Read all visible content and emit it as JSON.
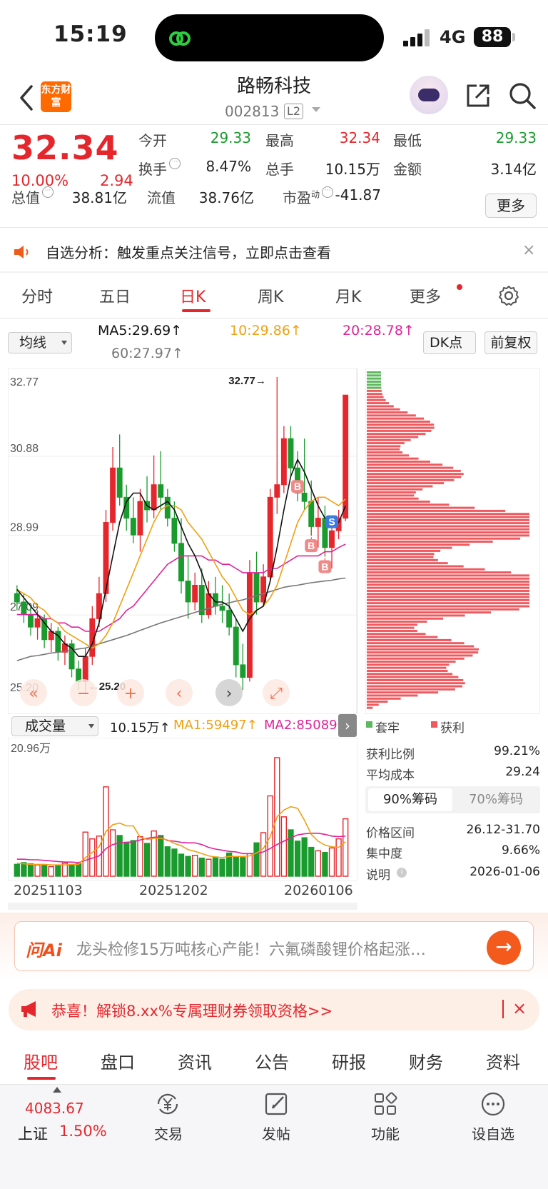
{
  "status": {
    "time": "15:19",
    "network": "4G",
    "battery": "88"
  },
  "header": {
    "logo": "东方财富",
    "name": "路畅科技",
    "code": "002813",
    "level": "L2"
  },
  "quote": {
    "price": "32.34",
    "change_pct": "10.00%",
    "change": "2.94",
    "cells": [
      {
        "label": "今开",
        "value": "29.33",
        "color": "green"
      },
      {
        "label": "最高",
        "value": "32.34",
        "color": "red"
      },
      {
        "label": "最低",
        "value": "29.33",
        "color": "green"
      },
      {
        "label": "换手",
        "value": "8.47%",
        "color": "black"
      },
      {
        "label": "总手",
        "value": "10.15万",
        "color": "black"
      },
      {
        "label": "金额",
        "value": "3.14亿",
        "color": "black"
      },
      {
        "label": "总值",
        "value": "38.81亿",
        "color": "black"
      },
      {
        "label": "流值",
        "value": "38.76亿",
        "color": "black"
      },
      {
        "label": "市盈",
        "value": "-41.87",
        "color": "black"
      }
    ],
    "pe_sup": "动",
    "more_label": "更多"
  },
  "notice": {
    "text": "自选分析：触发重点关注信号，立即点击查看",
    "close": "×"
  },
  "ktabs": [
    "分时",
    "五日",
    "日K",
    "周K",
    "月K",
    "更多"
  ],
  "ma_row": {
    "select": "均线",
    "ma5": "MA5:29.69↑",
    "ma10": "10:29.86↑",
    "ma20": "20:28.78↑",
    "ma60": "60:27.97↑",
    "dk": "DK点",
    "fq": "前复权",
    "colors": {
      "ma5": "#111111",
      "ma10": "#f0a010",
      "ma20": "#e0239a",
      "ma60": "#777777"
    }
  },
  "chart_data": [
    {
      "type": "candlestick",
      "y_ticks": [
        "32.77",
        "30.88",
        "28.99",
        "27.09",
        "25.20"
      ],
      "ylim": [
        25.2,
        32.77
      ],
      "high_label": "32.77→",
      "low_label": "←25.20",
      "markers": [
        "B",
        "B",
        "B",
        "S"
      ],
      "candles": [
        [
          27.6,
          27.8,
          27.2,
          27.4
        ],
        [
          27.4,
          27.6,
          26.9,
          27.1
        ],
        [
          27.1,
          27.3,
          26.6,
          26.8
        ],
        [
          26.8,
          27.2,
          26.5,
          27.0
        ],
        [
          27.0,
          27.1,
          26.3,
          26.5
        ],
        [
          26.5,
          26.9,
          26.2,
          26.7
        ],
        [
          26.7,
          26.8,
          26.0,
          26.2
        ],
        [
          26.2,
          26.6,
          25.9,
          26.4
        ],
        [
          26.4,
          26.5,
          25.6,
          25.8
        ],
        [
          25.8,
          26.0,
          25.3,
          25.5
        ],
        [
          25.5,
          26.3,
          25.2,
          26.1
        ],
        [
          26.1,
          27.3,
          25.9,
          27.0
        ],
        [
          27.0,
          28.0,
          26.8,
          27.6
        ],
        [
          27.6,
          29.6,
          27.4,
          29.3
        ],
        [
          29.3,
          31.1,
          29.1,
          30.6
        ],
        [
          30.6,
          31.4,
          29.7,
          29.9
        ],
        [
          29.9,
          30.2,
          29.1,
          29.4
        ],
        [
          29.4,
          29.9,
          28.8,
          29.0
        ],
        [
          29.0,
          30.1,
          28.6,
          29.8
        ],
        [
          29.8,
          30.4,
          29.3,
          29.6
        ],
        [
          29.6,
          30.9,
          29.4,
          30.2
        ],
        [
          30.2,
          31.0,
          29.6,
          29.9
        ],
        [
          29.9,
          30.1,
          29.2,
          29.4
        ],
        [
          29.4,
          29.8,
          28.6,
          28.8
        ],
        [
          28.8,
          29.4,
          27.6,
          27.9
        ],
        [
          27.9,
          28.5,
          27.0,
          27.4
        ],
        [
          27.4,
          28.1,
          27.2,
          27.8
        ],
        [
          27.8,
          28.2,
          26.9,
          27.1
        ],
        [
          27.1,
          27.9,
          27.0,
          27.6
        ],
        [
          27.6,
          28.0,
          27.1,
          27.3
        ],
        [
          27.3,
          27.8,
          26.9,
          27.2
        ],
        [
          27.2,
          27.6,
          26.6,
          26.8
        ],
        [
          26.8,
          27.0,
          25.6,
          25.9
        ],
        [
          25.9,
          26.4,
          25.3,
          25.6
        ],
        [
          25.6,
          28.4,
          25.5,
          28.1
        ],
        [
          28.1,
          28.6,
          27.1,
          27.4
        ],
        [
          27.4,
          28.3,
          27.3,
          28.0
        ],
        [
          28.0,
          30.1,
          27.9,
          29.9
        ],
        [
          29.9,
          32.77,
          29.5,
          30.2
        ],
        [
          30.2,
          31.6,
          30.0,
          31.3
        ],
        [
          31.3,
          31.6,
          30.4,
          30.6
        ],
        [
          30.6,
          31.0,
          29.8,
          30.0
        ],
        [
          30.0,
          31.3,
          29.6,
          29.8
        ],
        [
          29.8,
          30.3,
          29.0,
          29.2
        ],
        [
          29.2,
          29.9,
          28.7,
          29.4
        ],
        [
          29.4,
          29.7,
          28.5,
          28.7
        ],
        [
          28.7,
          29.4,
          28.2,
          29.1
        ],
        [
          29.1,
          29.6,
          28.9,
          29.4
        ],
        [
          29.4,
          32.34,
          29.33,
          32.34
        ]
      ],
      "ma5": [
        27.7,
        27.5,
        27.3,
        27.1,
        26.9,
        26.7,
        26.6,
        26.4,
        26.3,
        26.1,
        26.1,
        26.4,
        26.9,
        27.7,
        28.5,
        29.3,
        29.8,
        30.0,
        30.0,
        29.7,
        29.6,
        29.7,
        29.8,
        29.6,
        29.2,
        28.8,
        28.5,
        28.1,
        27.6,
        27.4,
        27.4,
        27.3,
        27.0,
        26.7,
        27.0,
        27.2,
        27.3,
        27.9,
        28.7,
        29.6,
        30.4,
        30.8,
        30.5,
        30.1,
        29.7,
        29.4,
        29.3,
        29.3,
        29.69
      ],
      "ma10": [
        27.7,
        27.6,
        27.5,
        27.3,
        27.2,
        27.0,
        26.9,
        26.7,
        26.6,
        26.5,
        26.4,
        26.3,
        26.4,
        26.6,
        26.9,
        27.3,
        27.7,
        28.1,
        28.5,
        28.9,
        29.3,
        29.6,
        29.7,
        29.7,
        29.6,
        29.3,
        29.1,
        28.9,
        28.6,
        28.3,
        28.0,
        27.8,
        27.5,
        27.2,
        27.1,
        27.2,
        27.3,
        27.5,
        27.8,
        28.3,
        28.8,
        29.3,
        29.6,
        29.8,
        29.9,
        29.9,
        29.8,
        29.7,
        29.86
      ],
      "ma20": [
        27.1,
        27.1,
        27.1,
        27.1,
        27.0,
        27.0,
        26.9,
        26.9,
        26.8,
        26.8,
        26.7,
        26.7,
        26.7,
        26.8,
        26.9,
        27.0,
        27.2,
        27.3,
        27.5,
        27.7,
        27.9,
        28.1,
        28.3,
        28.4,
        28.5,
        28.5,
        28.5,
        28.5,
        28.4,
        28.4,
        28.3,
        28.3,
        28.2,
        28.1,
        28.1,
        28.1,
        28.1,
        28.2,
        28.2,
        28.3,
        28.4,
        28.5,
        28.5,
        28.5,
        28.5,
        28.6,
        28.6,
        28.7,
        28.78
      ],
      "ma60": [
        26.0,
        26.05,
        26.1,
        26.12,
        26.15,
        26.18,
        26.2,
        26.22,
        26.25,
        26.28,
        26.3,
        26.35,
        26.4,
        26.45,
        26.5,
        26.55,
        26.6,
        26.66,
        26.72,
        26.78,
        26.84,
        26.9,
        26.95,
        27.0,
        27.05,
        27.1,
        27.15,
        27.2,
        27.25,
        27.3,
        27.35,
        27.38,
        27.42,
        27.45,
        27.5,
        27.55,
        27.6,
        27.65,
        27.7,
        27.75,
        27.78,
        27.8,
        27.83,
        27.86,
        27.88,
        27.9,
        27.92,
        27.95,
        27.97
      ]
    },
    {
      "type": "bar",
      "title": "成交量",
      "y_tick": "20.96万",
      "ylim": [
        0,
        20.96
      ],
      "x_tick_labels": [
        "20251103",
        "20251202",
        "20260106"
      ],
      "values": [
        2.1,
        2.4,
        2.2,
        2.0,
        1.9,
        1.7,
        1.9,
        2.3,
        2.0,
        2.2,
        7.8,
        6.6,
        7.1,
        15.8,
        8.2,
        7.2,
        6.0,
        6.3,
        7.0,
        5.8,
        8.0,
        7.2,
        5.2,
        4.8,
        3.9,
        3.5,
        3.7,
        3.2,
        3.0,
        3.4,
        3.0,
        4.1,
        3.5,
        3.3,
        4.0,
        5.9,
        7.7,
        14.2,
        20.96,
        10.5,
        8.2,
        6.2,
        6.8,
        5.1,
        4.5,
        4.2,
        5.0,
        6.6,
        10.15
      ],
      "ma1": [
        2.3,
        2.2,
        2.1,
        2.1,
        2.1,
        2.0,
        2.0,
        2.0,
        2.1,
        2.1,
        3.3,
        4.2,
        5.2,
        7.9,
        9.1,
        9.4,
        8.9,
        8.9,
        6.9,
        6.5,
        6.7,
        6.7,
        6.4,
        5.8,
        5.4,
        4.7,
        4.4,
        4.0,
        3.6,
        3.4,
        3.3,
        3.5,
        3.5,
        3.5,
        3.6,
        4.1,
        4.9,
        7.0,
        10.5,
        11.7,
        12.3,
        12.0,
        9.9,
        7.4,
        6.2,
        5.5,
        5.2,
        5.1,
        6.1
      ],
      "ma2": [
        3.0,
        3.0,
        2.9,
        2.9,
        2.8,
        2.7,
        2.6,
        2.5,
        2.5,
        2.4,
        2.8,
        3.2,
        3.6,
        4.9,
        5.6,
        5.9,
        6.0,
        6.1,
        6.4,
        6.7,
        6.9,
        6.9,
        6.3,
        6.2,
        6.0,
        5.9,
        5.9,
        5.6,
        5.1,
        4.8,
        4.6,
        4.4,
        4.3,
        4.0,
        4.0,
        4.0,
        4.3,
        4.9,
        5.6,
        6.2,
        6.8,
        7.3,
        7.5,
        7.6,
        7.6,
        7.4,
        7.1,
        7.0,
        7.1
      ],
      "legend": {
        "vol": "10.15万↑",
        "ma1": "MA1:59497↑",
        "ma2": "MA2:85089"
      }
    }
  ],
  "chip": {
    "legend_trapped": "套牢",
    "legend_profit": "获利",
    "profit_label": "获利比例",
    "profit_value": "99.21%",
    "avg_label": "平均成本",
    "avg_value": "29.24",
    "tab1": "90%筹码",
    "tab2": "70%筹码",
    "range_label": "价格区间",
    "range_value": "26.12-31.70",
    "conc_label": "集中度",
    "conc_value": "9.66%",
    "note_label": "说明",
    "note_value": "2026-01-06",
    "colors": {
      "profit": "#ee5a5f",
      "trapped": "#5cb85c"
    }
  },
  "ai": {
    "logo": "问Ai",
    "text": "龙头检修15万吨核心产能！六氟磷酸锂价格起涨…"
  },
  "promo": {
    "text": "恭喜！解锁8.xx%专属理财券领取资格>>"
  },
  "bottom_tabs": [
    "股吧",
    "盘口",
    "资讯",
    "公告",
    "研报",
    "财务",
    "资料"
  ],
  "footer": {
    "index_value": "4083.67",
    "index_name": "上证",
    "index_pct": "1.50%",
    "buttons": [
      {
        "label": "交易",
        "icon": "yen-exchange-icon"
      },
      {
        "label": "发帖",
        "icon": "edit-icon"
      },
      {
        "label": "功能",
        "icon": "apps-icon"
      },
      {
        "label": "设自选",
        "icon": "more-circle-icon"
      }
    ]
  },
  "chart_controls": [
    "«",
    "−",
    "+",
    "‹",
    "›",
    "⤢"
  ]
}
